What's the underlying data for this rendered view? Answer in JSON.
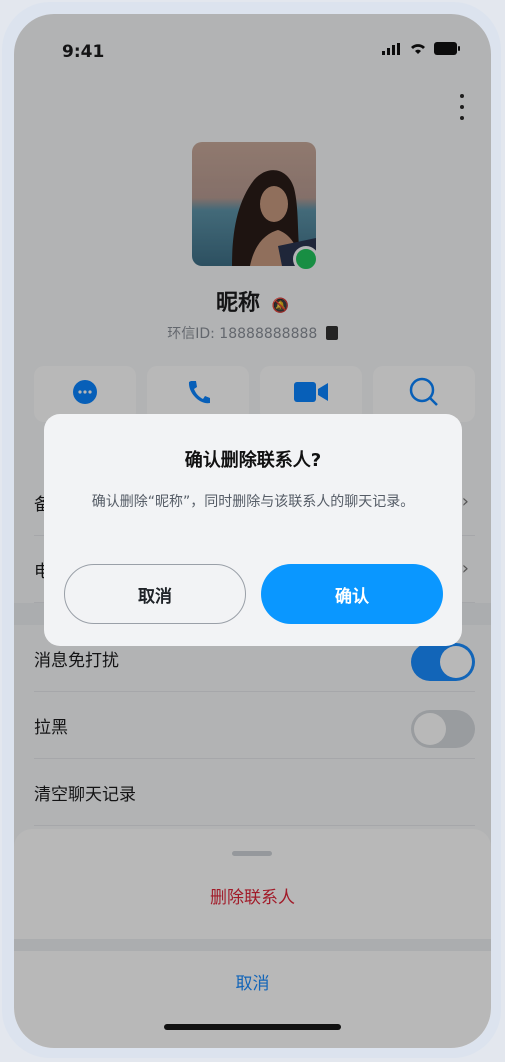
{
  "status": {
    "time": "9:41"
  },
  "profile": {
    "nickname": "昵称",
    "id_label": "环信ID: 18888888888"
  },
  "rows": {
    "remark_partial": "备",
    "phone_partial": "电",
    "mute_label": "消息免打扰",
    "block_label": "拉黑",
    "clear_label": "清空聊天记录"
  },
  "toggles": {
    "mute_on": true,
    "block_on": false
  },
  "sheet": {
    "delete_label": "删除联系人",
    "cancel_label": "取消"
  },
  "dialog": {
    "title": "确认删除联系人?",
    "message": "确认删除“昵称”，同时删除与该联系人的聊天记录。",
    "cancel_label": "取消",
    "confirm_label": "确认"
  },
  "colors": {
    "accent": "#0a97ff",
    "danger": "#e0263a",
    "online": "#22c55e",
    "overlay": "rgba(0,0,0,0.28)"
  }
}
